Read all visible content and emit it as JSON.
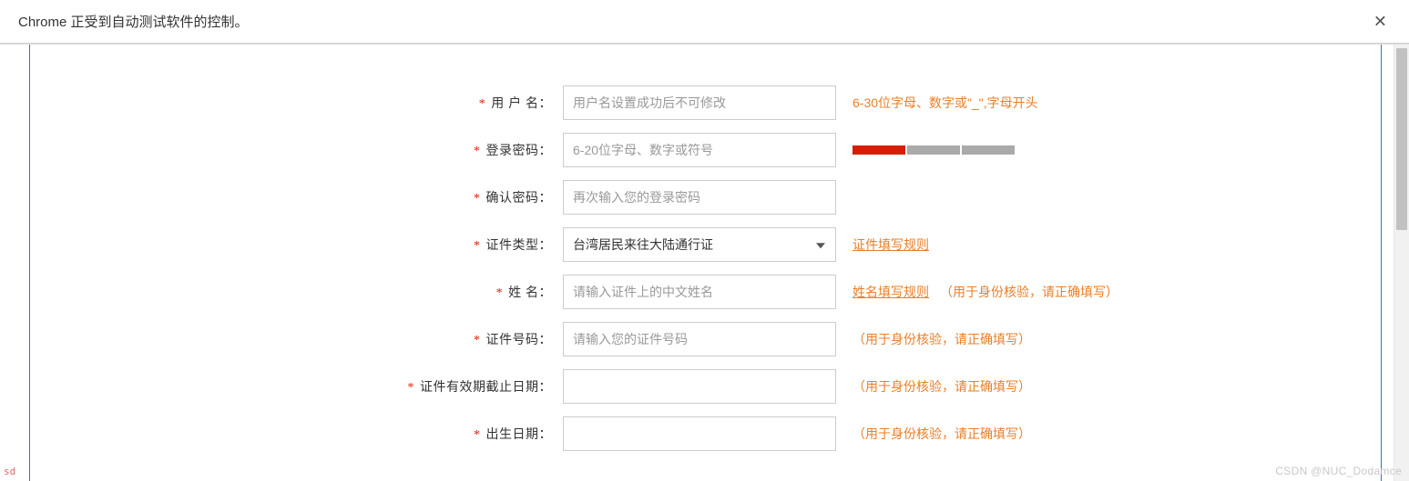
{
  "infobar": {
    "message": "Chrome 正受到自动测试软件的控制。"
  },
  "form": {
    "username": {
      "label": "用 户 名：",
      "placeholder": "用户名设置成功后不可修改",
      "hint": "6-30位字母、数字或\"_\",字母开头"
    },
    "password": {
      "label": "登录密码：",
      "placeholder": "6-20位字母、数字或符号"
    },
    "confirm": {
      "label": "确认密码：",
      "placeholder": "再次输入您的登录密码"
    },
    "idtype": {
      "label": "证件类型：",
      "value": "台湾居民来往大陆通行证",
      "link": "证件填写规则"
    },
    "name": {
      "label": "姓 名：",
      "placeholder": "请输入证件上的中文姓名",
      "link": "姓名填写规则",
      "hint": "（用于身份核验，请正确填写）"
    },
    "idnum": {
      "label": "证件号码：",
      "placeholder": "请输入您的证件号码",
      "hint": "（用于身份核验，请正确填写）"
    },
    "expiry": {
      "label": "证件有效期截止日期：",
      "hint": "（用于身份核验，请正确填写）"
    },
    "birth": {
      "label": "出生日期：",
      "hint": "（用于身份核验，请正确填写）"
    }
  },
  "watermark": "CSDN @NUC_Dodamce",
  "sd": "sd"
}
